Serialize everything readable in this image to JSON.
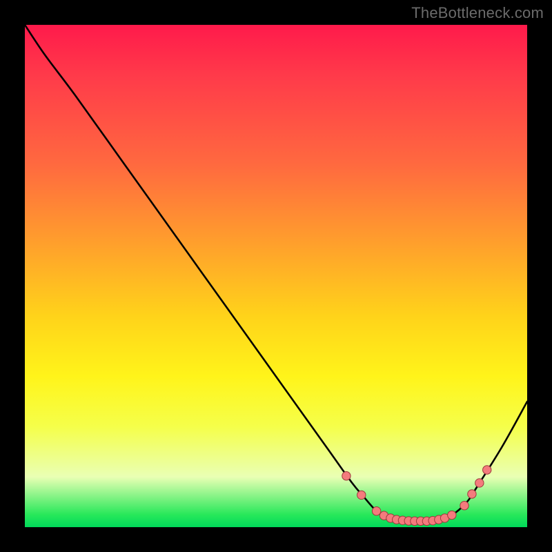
{
  "watermark": "TheBottleneck.com",
  "colors": {
    "background": "#000000",
    "curve": "#000000",
    "marker_fill": "#f47b7d",
    "marker_stroke": "#9c3a3c",
    "watermark": "#6b6b6b"
  },
  "chart_data": {
    "type": "line",
    "title": "",
    "xlabel": "",
    "ylabel": "",
    "xlim": [
      0,
      100
    ],
    "ylim": [
      0,
      100
    ],
    "grid": false,
    "legend": false,
    "series": [
      {
        "name": "bottleneck-curve",
        "x": [
          0,
          4,
          10,
          20,
          30,
          40,
          50,
          60,
          65,
          67.5,
          70,
          72,
          75,
          78,
          80,
          82,
          85,
          88,
          90,
          95,
          100
        ],
        "y": [
          100,
          94,
          86,
          72,
          58,
          44,
          30,
          16,
          9,
          6,
          3.2,
          2,
          1.4,
          1.2,
          1.2,
          1.4,
          2.4,
          5,
          8,
          16,
          25
        ]
      }
    ],
    "markers": [
      {
        "x": 64,
        "y": 10.2
      },
      {
        "x": 67,
        "y": 6.4
      },
      {
        "x": 70,
        "y": 3.2
      },
      {
        "x": 71.5,
        "y": 2.3
      },
      {
        "x": 72.8,
        "y": 1.8
      },
      {
        "x": 74,
        "y": 1.5
      },
      {
        "x": 75.2,
        "y": 1.35
      },
      {
        "x": 76.4,
        "y": 1.25
      },
      {
        "x": 77.6,
        "y": 1.2
      },
      {
        "x": 78.8,
        "y": 1.2
      },
      {
        "x": 80,
        "y": 1.2
      },
      {
        "x": 81.2,
        "y": 1.3
      },
      {
        "x": 82.4,
        "y": 1.5
      },
      {
        "x": 83.6,
        "y": 1.8
      },
      {
        "x": 85,
        "y": 2.4
      },
      {
        "x": 87.5,
        "y": 4.3
      },
      {
        "x": 89,
        "y": 6.6
      },
      {
        "x": 90.5,
        "y": 8.8
      },
      {
        "x": 92,
        "y": 11.4
      }
    ]
  }
}
